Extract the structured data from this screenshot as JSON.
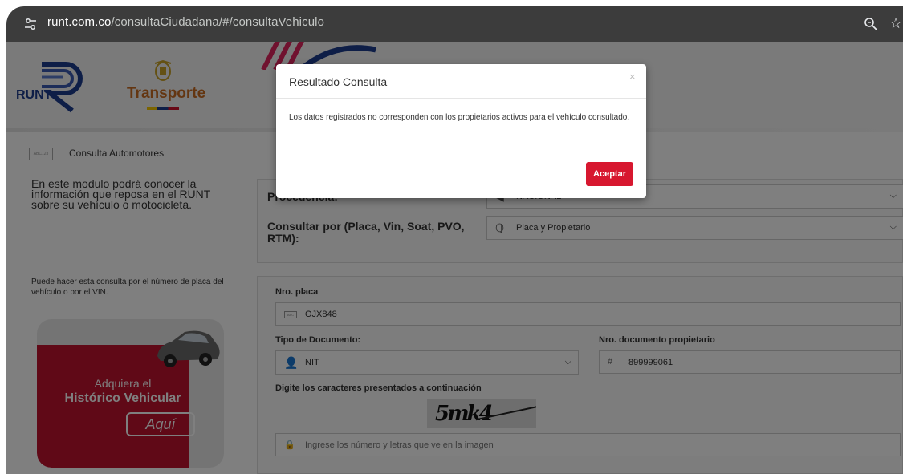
{
  "browser": {
    "url_host": "runt.com.co",
    "url_path": "/consultaCiudadana/#/consultaVehiculo",
    "icons": [
      "tune-icon",
      "zoom-icon",
      "star-icon"
    ]
  },
  "header": {
    "runt_logo_text": "RUNT",
    "transporte_logo_text": "Transporte"
  },
  "module": {
    "label": "Consulta Automotores",
    "icon_text": "ABC123"
  },
  "left": {
    "intro": "En este modulo podrá conocer la información que reposa en el RUNT sobre su vehículo o motocicleta.",
    "hint": "Puede hacer esta consulta por el número de placa del vehículo o por el VIN.",
    "promo_line1": "Adquiera el",
    "promo_line2": "Histórico Vehicular",
    "promo_button": "Aquí"
  },
  "form": {
    "procedencia_label": "Procedencia:",
    "procedencia_value": "NACIONAL",
    "consultar_label": "Consultar por (Placa, Vin, Soat, PVO, RTM):",
    "consultar_value": "Placa y Propietario",
    "placa_label": "Nro. placa",
    "placa_value": "OJX848",
    "tipo_doc_label": "Tipo de Documento:",
    "tipo_doc_value": "NIT",
    "nro_doc_label": "Nro. documento propietario",
    "nro_doc_value": "899999061",
    "captcha_label": "Digite los caracteres presentados a continuación",
    "captcha_text": "5mk4",
    "captcha_placeholder": "Ingrese los número y letras que ve en la imagen"
  },
  "modal": {
    "title": "Resultado Consulta",
    "close": "×",
    "message": "Los datos registrados no corresponden con los propietarios activos para el vehículo consultado.",
    "accept": "Aceptar"
  },
  "colors": {
    "accent_red": "#d7172f",
    "runt_blue": "#1d3d8f",
    "transporte_orange": "#c96c23"
  }
}
